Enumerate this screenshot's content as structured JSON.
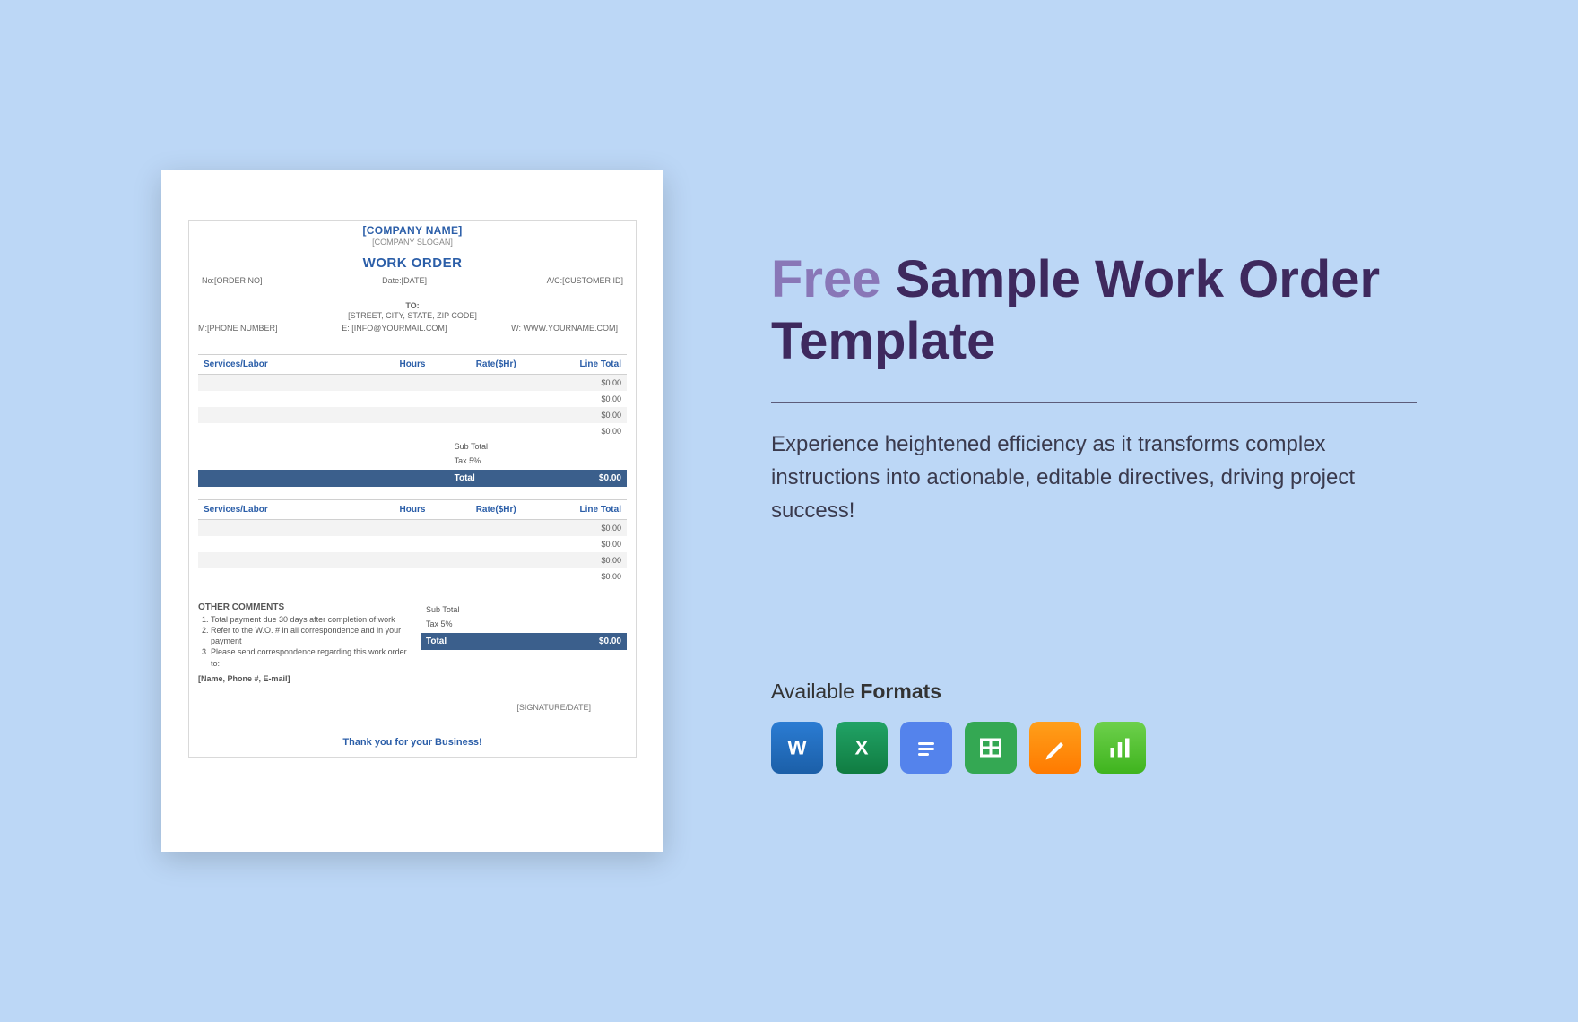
{
  "doc": {
    "companyName": "[COMPANY NAME]",
    "companySlogan": "[COMPANY SLOGAN]",
    "title": "WORK ORDER",
    "orderNoLabel": "No:[ORDER NO]",
    "dateLabel": "Date:[DATE]",
    "acLabel": "A/C:[CUSTOMER ID]",
    "to": "TO:",
    "address": "[STREET, CITY, STATE, ZIP CODE]",
    "phone": "M:[PHONE NUMBER]",
    "email": "E: [INFO@YOURMAIL.COM]",
    "web": "W: WWW.YOURNAME.COM]",
    "headers": {
      "c1": "Services/Labor",
      "c2": "Hours",
      "c3": "Rate($Hr)",
      "c4": "Line Total"
    },
    "lineValue": "$0.00",
    "subtotal": "Sub Total",
    "tax": "Tax 5%",
    "total": "Total",
    "totalValue": "$0.00",
    "commentsHd": "OTHER COMMENTS",
    "comment1": "Total payment due 30 days after completion of work",
    "comment2": "Refer to the W.O. # in all correspondence and in your payment",
    "comment3": "Please send correspondence regarding this work order to:",
    "nameLine": "[Name, Phone #, E-mail]",
    "signature": "[SIGNATURE/DATE]",
    "thankYou": "Thank you for your Business!"
  },
  "panel": {
    "titleFree": "Free",
    "titleRest": " Sample Work Order Template",
    "description": "Experience heightened efficiency as it transforms complex instructions into actionable, editable directives, driving project success!",
    "formatsLabel1": "Available ",
    "formatsLabel2": "Formats"
  }
}
